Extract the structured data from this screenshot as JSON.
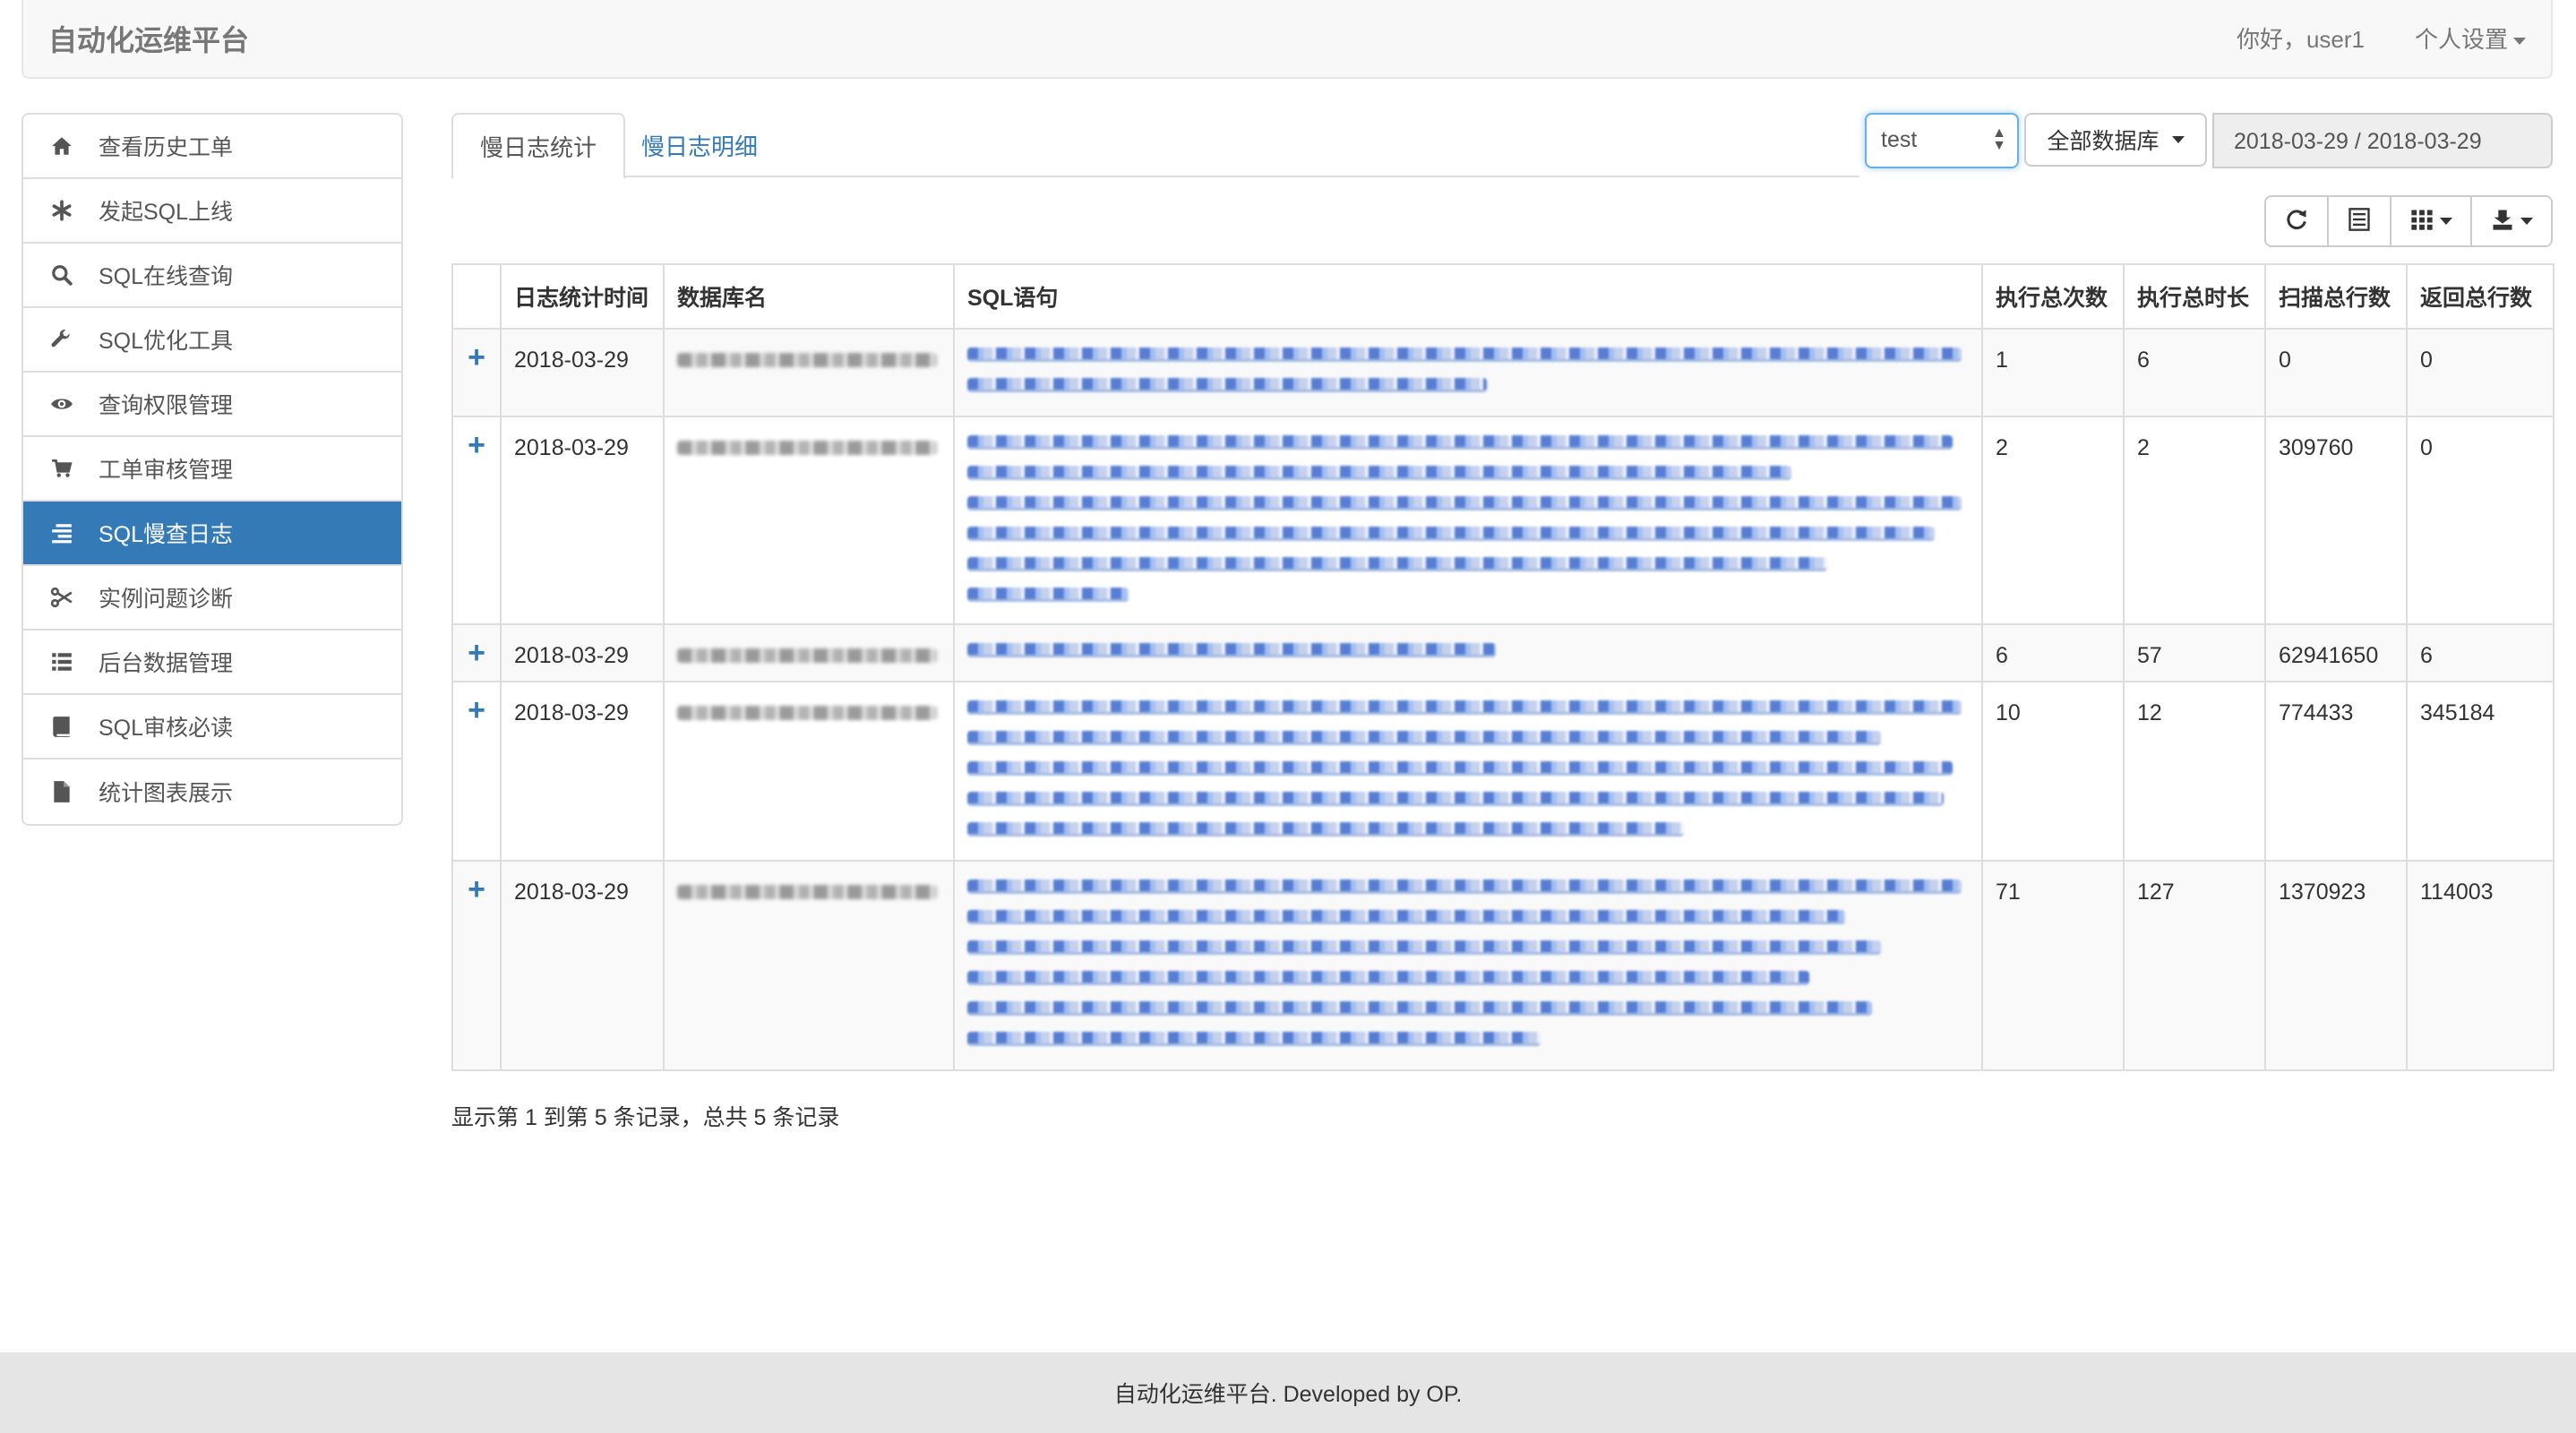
{
  "app": {
    "title": "自动化运维平台"
  },
  "nav": {
    "greeting": "你好，user1",
    "settings": "个人设置"
  },
  "sidebar": {
    "items": [
      {
        "label": "查看历史工单",
        "icon": "home-icon"
      },
      {
        "label": "发起SQL上线",
        "icon": "asterisk-icon"
      },
      {
        "label": "SQL在线查询",
        "icon": "search-icon"
      },
      {
        "label": "SQL优化工具",
        "icon": "wrench-icon"
      },
      {
        "label": "查询权限管理",
        "icon": "eye-icon"
      },
      {
        "label": "工单审核管理",
        "icon": "cart-icon"
      },
      {
        "label": "SQL慢查日志",
        "icon": "align-right-icon",
        "active": true
      },
      {
        "label": "实例问题诊断",
        "icon": "scissors-icon"
      },
      {
        "label": "后台数据管理",
        "icon": "list-icon"
      },
      {
        "label": "SQL审核必读",
        "icon": "book-icon"
      },
      {
        "label": "统计图表展示",
        "icon": "file-icon"
      }
    ]
  },
  "tabs": [
    {
      "label": "慢日志统计",
      "active": true
    },
    {
      "label": "慢日志明细",
      "active": false
    }
  ],
  "filters": {
    "instance": "test",
    "database": "全部数据库",
    "date_range": "2018-03-29 / 2018-03-29"
  },
  "table": {
    "headers": [
      "日志统计时间",
      "数据库名",
      "SQL语句",
      "执行总次数",
      "执行总时长",
      "扫描总行数",
      "返回总行数"
    ],
    "rows": [
      {
        "date": "2018-03-29",
        "count": "1",
        "duration": "6",
        "scanned": "0",
        "returned": "0"
      },
      {
        "date": "2018-03-29",
        "count": "2",
        "duration": "2",
        "scanned": "309760",
        "returned": "0"
      },
      {
        "date": "2018-03-29",
        "count": "6",
        "duration": "57",
        "scanned": "62941650",
        "returned": "6"
      },
      {
        "date": "2018-03-29",
        "count": "10",
        "duration": "12",
        "scanned": "774433",
        "returned": "345184"
      },
      {
        "date": "2018-03-29",
        "count": "71",
        "duration": "127",
        "scanned": "1370923",
        "returned": "114003"
      }
    ]
  },
  "pagination": {
    "summary": "显示第 1 到第 5 条记录，总共 5 条记录"
  },
  "footer": {
    "text": "自动化运维平台. Developed by OP."
  },
  "colors": {
    "primary": "#337ab7",
    "active_bg": "#337ab7"
  }
}
